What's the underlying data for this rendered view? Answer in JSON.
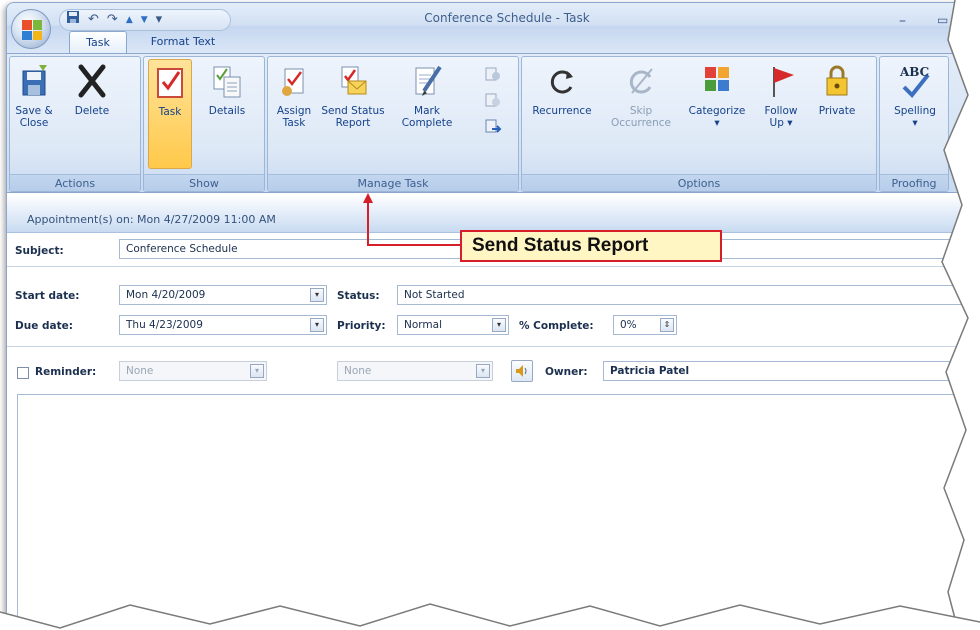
{
  "window": {
    "title": "Conference Schedule - Task",
    "minimize_glyph": "–",
    "restore_glyph": "▭"
  },
  "quick_access": {
    "save_icon": "save-icon",
    "undo_glyph": "↶",
    "redo_glyph": "↷",
    "up_glyph": "▲",
    "down_glyph": "▼",
    "customize_glyph": "▾"
  },
  "tabs": [
    {
      "label": "Task",
      "active": true
    },
    {
      "label": "Format Text",
      "active": false
    }
  ],
  "ribbon": {
    "groups": {
      "actions": "Actions",
      "show": "Show",
      "manage_task": "Manage Task",
      "options": "Options",
      "proofing": "Proofing"
    },
    "buttons": {
      "save_close": [
        "Save &",
        "Close"
      ],
      "delete": "Delete",
      "task": "Task",
      "details": "Details",
      "assign_task": [
        "Assign",
        "Task"
      ],
      "send_status_report": [
        "Send Status",
        "Report"
      ],
      "mark_complete": [
        "Mark",
        "Complete"
      ],
      "recurrence": "Recurrence",
      "skip_occurrence": [
        "Skip",
        "Occurrence"
      ],
      "categorize": [
        "Categorize",
        "▾"
      ],
      "follow_up": [
        "Follow",
        "Up ▾"
      ],
      "private": "Private",
      "spelling": [
        "Spelling",
        "▾"
      ],
      "abc": "ABC"
    }
  },
  "info_bar": "Appointment(s) on: Mon 4/27/2009 11:00 AM",
  "form": {
    "subject_label": "Subject:",
    "subject_value": "Conference Schedule",
    "start_label": "Start date:",
    "start_value": "Mon 4/20/2009",
    "due_label": "Due date:",
    "due_value": "Thu 4/23/2009",
    "status_label": "Status:",
    "status_value": "Not Started",
    "priority_label": "Priority:",
    "priority_value": "Normal",
    "complete_label": "% Complete:",
    "complete_value": "0%",
    "reminder_label": "Reminder:",
    "reminder_date": "None",
    "reminder_time": "None",
    "owner_label": "Owner:",
    "owner_value": "Patricia Patel",
    "dropdown_glyph": "▾",
    "spin_glyph": "⇕"
  },
  "callout": "Send Status Report",
  "colors": {
    "ribbon_bg": "#d6e4f5",
    "accent_blue": "#15428b",
    "callout_red": "#d61f29",
    "callout_fill": "#fff6c4",
    "selected_orange": "#ffc94a"
  }
}
